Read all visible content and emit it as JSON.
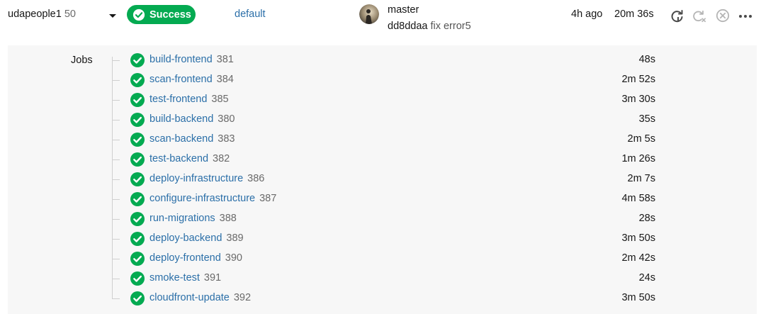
{
  "header": {
    "project_name": "udapeople1",
    "pipeline_number": "50",
    "status_label": "Success",
    "workflow_name": "default",
    "branch": "master",
    "commit_sha": "dd8ddaa",
    "commit_message": "fix error5",
    "time_ago": "4h ago",
    "duration": "20m 36s",
    "icons": [
      "rerun-icon",
      "rerun-failed-icon",
      "cancel-icon",
      "more-options-icon"
    ]
  },
  "jobs_section": {
    "label": "Jobs",
    "jobs": [
      {
        "name": "build-frontend",
        "number": "381",
        "duration": "48s"
      },
      {
        "name": "scan-frontend",
        "number": "384",
        "duration": "2m 52s"
      },
      {
        "name": "test-frontend",
        "number": "385",
        "duration": "3m 30s"
      },
      {
        "name": "build-backend",
        "number": "380",
        "duration": "35s"
      },
      {
        "name": "scan-backend",
        "number": "383",
        "duration": "2m 5s"
      },
      {
        "name": "test-backend",
        "number": "382",
        "duration": "1m 26s"
      },
      {
        "name": "deploy-infrastructure",
        "number": "386",
        "duration": "2m 7s"
      },
      {
        "name": "configure-infrastructure",
        "number": "387",
        "duration": "4m 58s"
      },
      {
        "name": "run-migrations",
        "number": "388",
        "duration": "28s"
      },
      {
        "name": "deploy-backend",
        "number": "389",
        "duration": "3m 50s"
      },
      {
        "name": "deploy-frontend",
        "number": "390",
        "duration": "2m 42s"
      },
      {
        "name": "smoke-test",
        "number": "391",
        "duration": "24s"
      },
      {
        "name": "cloudfront-update",
        "number": "392",
        "duration": "3m 50s"
      }
    ]
  },
  "colors": {
    "success": "#04aa51",
    "link": "#2b6fa8",
    "panel_bg": "#f7f7f7"
  }
}
